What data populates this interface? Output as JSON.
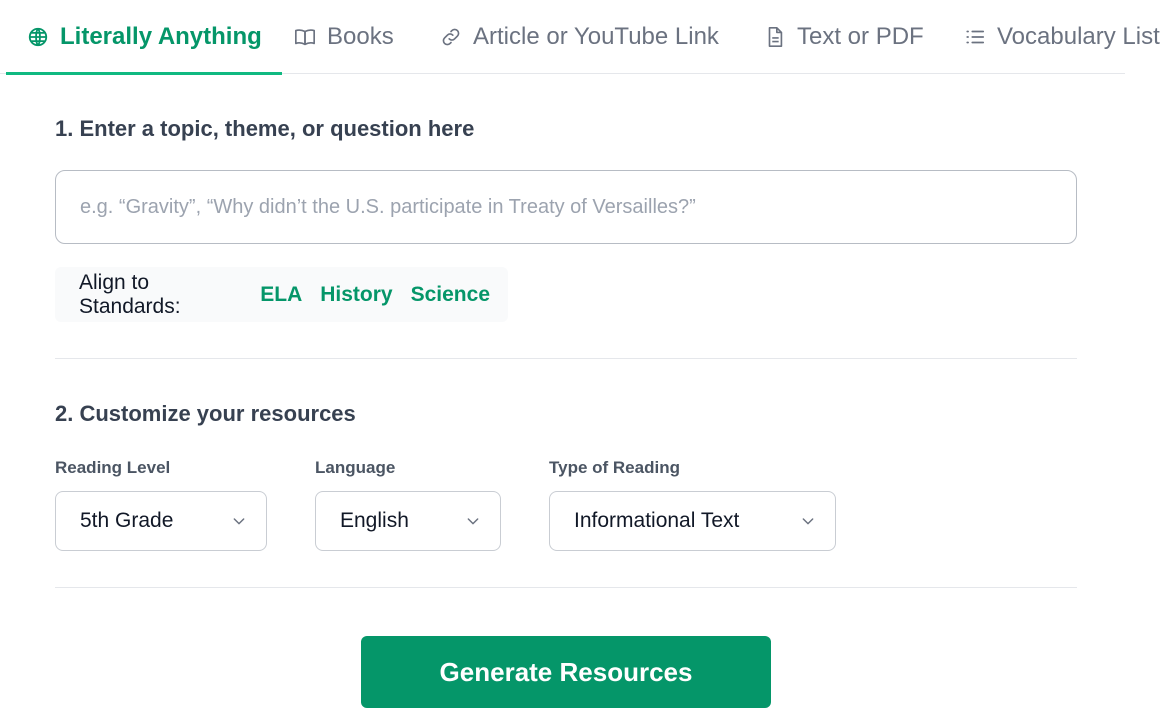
{
  "tabs": [
    {
      "label": "Literally Anything",
      "icon": "globe-icon",
      "active": true
    },
    {
      "label": "Books",
      "icon": "book-open-icon",
      "active": false
    },
    {
      "label": "Article or YouTube Link",
      "icon": "link-icon",
      "active": false
    },
    {
      "label": "Text or PDF",
      "icon": "document-icon",
      "active": false
    },
    {
      "label": "Vocabulary List",
      "icon": "list-icon",
      "active": false
    }
  ],
  "step1": {
    "heading": "1. Enter a topic, theme, or question here",
    "input_value": "",
    "input_placeholder": "e.g. “Gravity”, “Why didn’t the U.S. participate in Treaty of Versailles?”",
    "standards_label": "Align to Standards:",
    "standards": [
      "ELA",
      "History",
      "Science"
    ]
  },
  "step2": {
    "heading": "2. Customize your resources",
    "reading_level": {
      "label": "Reading Level",
      "value": "5th Grade"
    },
    "language": {
      "label": "Language",
      "value": "English"
    },
    "reading_type": {
      "label": "Type of Reading",
      "value": "Informational Text"
    }
  },
  "generate_label": "Generate Resources",
  "colors": {
    "accent": "#059669",
    "accent_underline": "#10b981",
    "muted_text": "#6b7280",
    "border": "#e5e7eb"
  }
}
